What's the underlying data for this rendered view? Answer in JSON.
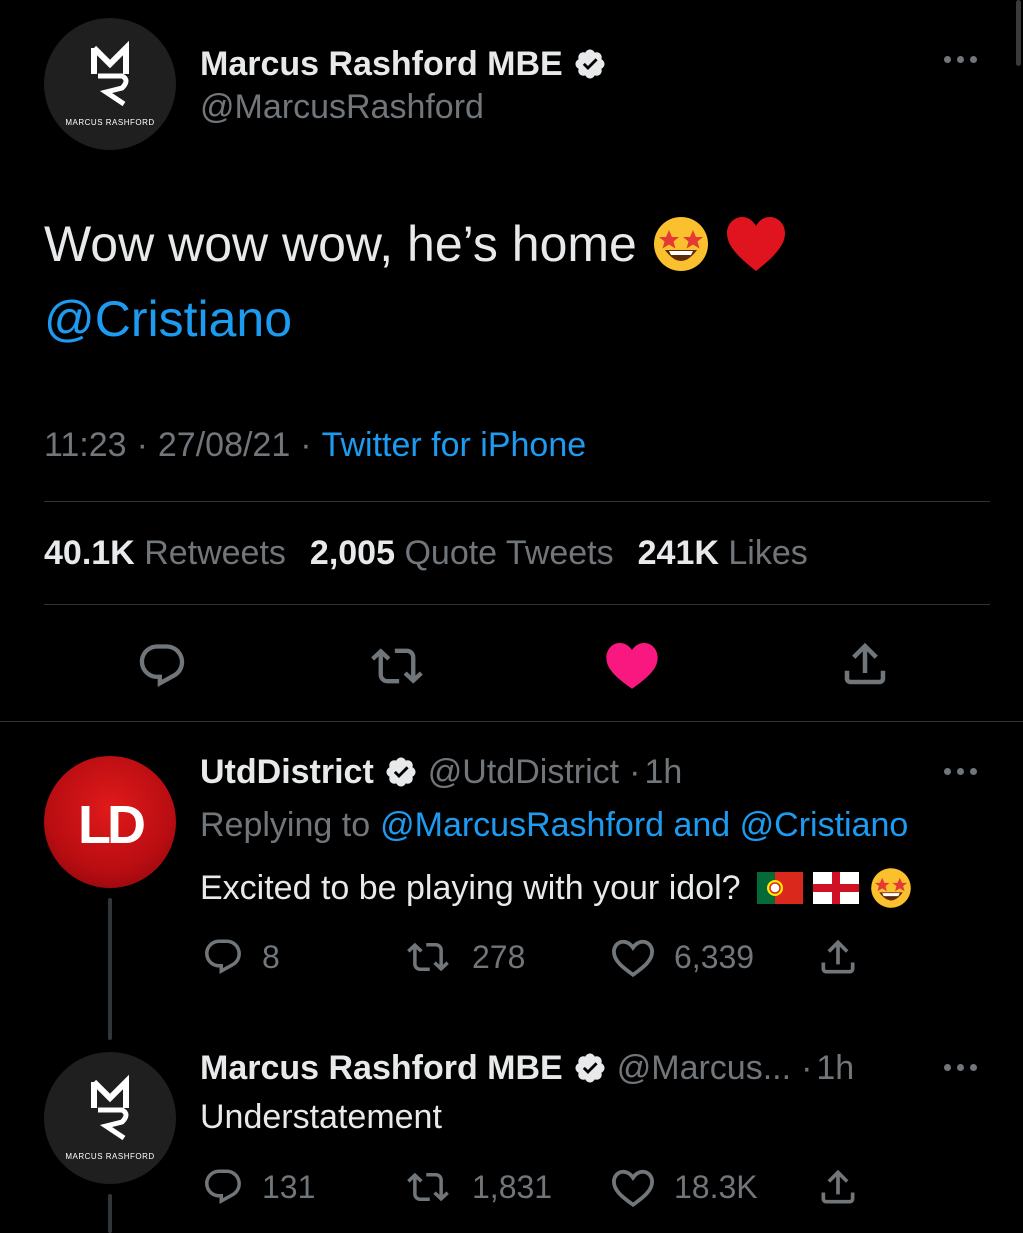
{
  "main_tweet": {
    "avatar_text": "MARCUS RASHFORD",
    "avatar_monogram_top": "M",
    "avatar_monogram_bottom": "R",
    "display_name": "Marcus Rashford MBE",
    "handle": "@MarcusRashford",
    "text": "Wow wow wow, he’s home",
    "emoji_1": "star-struck-emoji",
    "emoji_2": "red-heart-emoji",
    "mention": "@Cristiano",
    "time": "11:23",
    "date": "27/08/21",
    "source": "Twitter for iPhone",
    "stats": {
      "retweets_count": "40.1K",
      "retweets_label": "Retweets",
      "quotes_count": "2,005",
      "quotes_label": "Quote Tweets",
      "likes_count": "241K",
      "likes_label": "Likes"
    }
  },
  "reply_1": {
    "avatar_text": "LD",
    "display_name": "UtdDistrict",
    "handle": "@UtdDistrict",
    "age": "1h",
    "replying_prefix": "Replying to",
    "replying_to": "@MarcusRashford and @Cristiano",
    "text": "Excited to be playing with your idol?",
    "emojis": [
      "portugal-flag",
      "england-flag",
      "star-struck-emoji"
    ],
    "replies": "8",
    "retweets": "278",
    "likes": "6,339"
  },
  "reply_2": {
    "avatar_text": "MARCUS RASHFORD",
    "display_name": "Marcus Rashford MBE",
    "handle": "@Marcus...",
    "age": "1h",
    "text": "Understatement",
    "replies": "131",
    "retweets": "1,831",
    "likes": "18.3K"
  },
  "colors": {
    "background": "#000000",
    "text": "#e7e9ea",
    "secondary": "#71767b",
    "link": "#1d9bf0",
    "like_active": "#f91880",
    "divider": "#2f3336"
  }
}
